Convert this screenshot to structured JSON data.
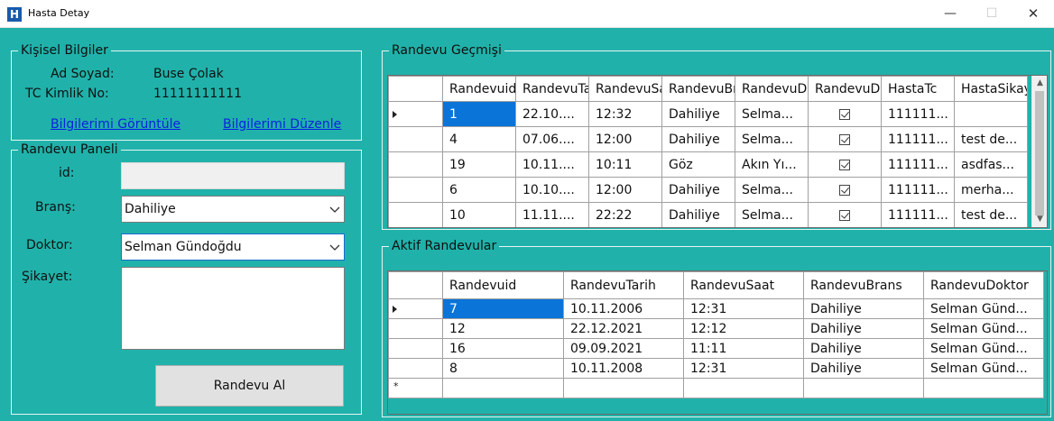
{
  "window": {
    "icon_letter": "H",
    "title": "Hasta Detay",
    "minimize": "—",
    "maximize": "☐",
    "close": "✕"
  },
  "personal": {
    "legend": "Kişisel Bilgiler",
    "name_label": "Ad Soyad:",
    "name_value": "Buse  Çolak",
    "tc_label": "TC Kimlik No:",
    "tc_value": "11111111111",
    "view_link": "Bilgilerimi Görüntüle",
    "edit_link": "Bilgilerimi Düzenle"
  },
  "appointment_panel": {
    "legend": "Randevu Paneli",
    "id_label": "id:",
    "id_value": "",
    "branch_label": "Branş:",
    "branch_value": "Dahiliye",
    "doctor_label": "Doktor:",
    "doctor_value": "Selman Gündoğdu",
    "complaint_label": "Şikayet:",
    "complaint_value": "",
    "submit_label": "Randevu Al"
  },
  "history": {
    "legend": "Randevu Geçmişi",
    "columns": [
      "Randevuid",
      "RandevuTarih",
      "RandevuSaat",
      "RandevuBrans",
      "RandevuDoktor",
      "RandevuDurum",
      "HastaTc",
      "HastaSikayet"
    ],
    "rows": [
      [
        "1",
        "22.10....",
        "12:32",
        "Dahiliye",
        "Selma...",
        true,
        "111111...",
        ""
      ],
      [
        "4",
        "07.06....",
        "12:00",
        "Dahiliye",
        "Selma...",
        true,
        "111111...",
        "test de..."
      ],
      [
        "19",
        "10.11....",
        "10:11",
        "Göz",
        "Akın Yı...",
        true,
        "111111...",
        "asdfas..."
      ],
      [
        "6",
        "10.10....",
        "12:00",
        "Dahiliye",
        "Selma...",
        true,
        "111111...",
        "merha..."
      ],
      [
        "10",
        "11.11....",
        "22:22",
        "Dahiliye",
        "Selma...",
        true,
        "111111...",
        "test de..."
      ]
    ],
    "selected_row": 0
  },
  "active": {
    "legend": "Aktif Randevular",
    "columns": [
      "Randevuid",
      "RandevuTarih",
      "RandevuSaat",
      "RandevuBrans",
      "RandevuDoktor"
    ],
    "rows": [
      [
        "7",
        "10.11.2006",
        "12:31",
        "Dahiliye",
        "Selman Günd..."
      ],
      [
        "12",
        "22.12.2021",
        "12:12",
        "Dahiliye",
        "Selman Günd..."
      ],
      [
        "16",
        "09.09.2021",
        "11:11",
        "Dahiliye",
        "Selman Günd..."
      ],
      [
        "8",
        "10.11.2008",
        "12:31",
        "Dahiliye",
        "Selman Günd..."
      ]
    ],
    "new_row_marker": "*",
    "selected_row": 0
  },
  "colors": {
    "form_background": "#20b2aa",
    "selection": "#0a74d8",
    "link": "#0b22e0"
  }
}
